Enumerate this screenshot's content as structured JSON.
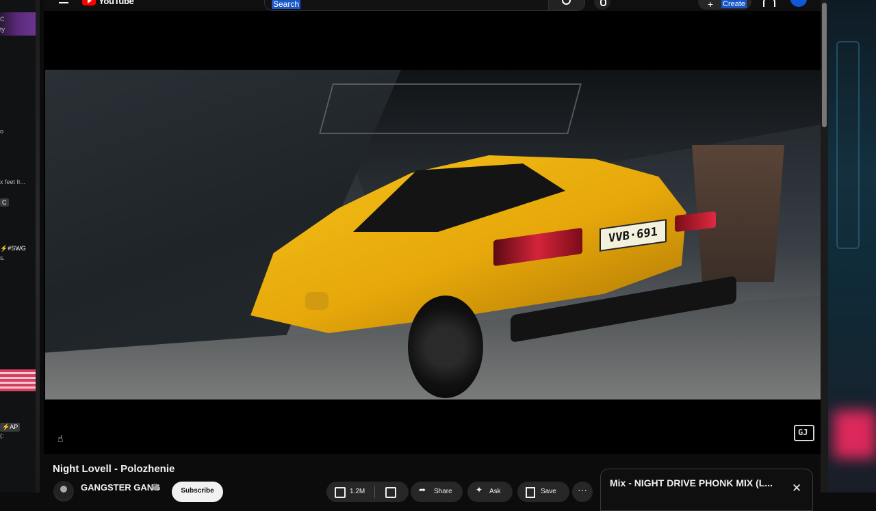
{
  "header": {
    "logo_text": "YouTube",
    "search_placeholder": "Search",
    "create_label": "Create"
  },
  "left_strip": {
    "snippets": [
      "C",
      "ty",
      "o",
      "x feet fr...",
      "C",
      "⚡#SWG",
      "s.",
      "⚡AP",
      "(:"
    ]
  },
  "video": {
    "plate_text": "VVB·691",
    "corner_logo": "GJ",
    "title": "Night Lovell - Polozhenie"
  },
  "channel": {
    "name": "GANGSTER GANG",
    "subscribe_label": "Subscribe"
  },
  "actions": {
    "like_count": "1.2M",
    "share_label": "Share",
    "ask_label": "Ask",
    "save_label": "Save",
    "more_label": "···"
  },
  "playlist": {
    "title": "Mix - NIGHT DRIVE PHONK MIX (L...",
    "close_symbol": "✕"
  },
  "colors": {
    "accent_red": "#ff0000",
    "car_yellow": "#f4c21a",
    "selection_blue": "#1a56c8"
  }
}
